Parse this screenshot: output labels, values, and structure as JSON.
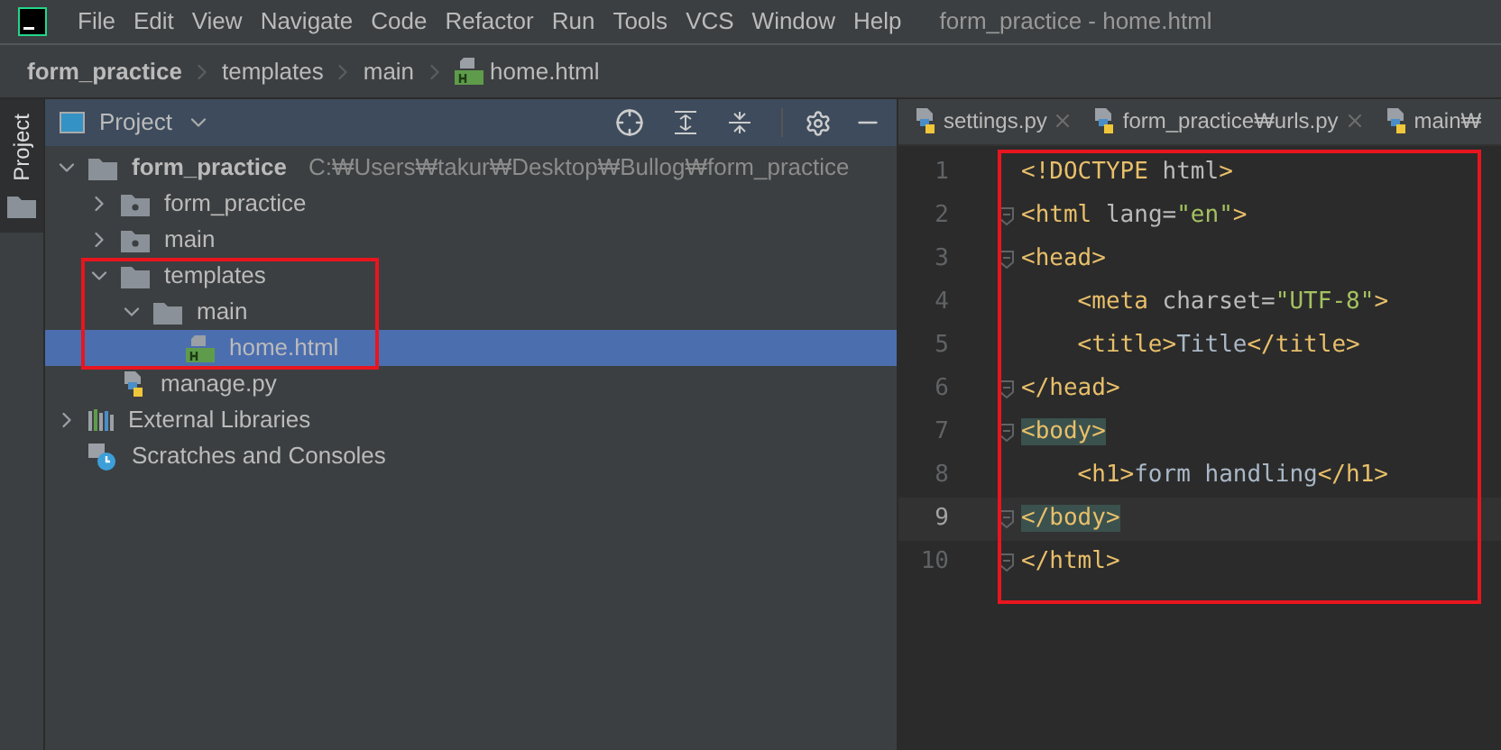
{
  "menu": [
    "File",
    "Edit",
    "View",
    "Navigate",
    "Code",
    "Refactor",
    "Run",
    "Tools",
    "VCS",
    "Window",
    "Help"
  ],
  "window": {
    "title": "form_practice - home.html"
  },
  "breadcrumb": [
    "form_practice",
    "templates",
    "main",
    "home.html"
  ],
  "tool_tab": {
    "label": "Project",
    "selected": true
  },
  "project_panel": {
    "title": "Project",
    "tree": [
      {
        "name": "form_practice",
        "path": "C:₩Users₩takur₩Desktop₩Bullog₩form_practice",
        "kind": "root",
        "expanded": true,
        "selected": false,
        "children": [
          {
            "name": "form_practice",
            "kind": "package",
            "expanded": false,
            "selected": false
          },
          {
            "name": "main",
            "kind": "package",
            "expanded": false,
            "selected": false
          },
          {
            "name": "templates",
            "kind": "folder",
            "expanded": true,
            "selected": false,
            "children": [
              {
                "name": "main",
                "kind": "folder",
                "expanded": true,
                "selected": false,
                "children": [
                  {
                    "name": "home.html",
                    "kind": "html",
                    "selected": true
                  }
                ]
              }
            ]
          },
          {
            "name": "manage.py",
            "kind": "python",
            "selected": false
          }
        ]
      },
      {
        "name": "External Libraries",
        "kind": "libraries",
        "expanded": false,
        "selected": false
      },
      {
        "name": "Scratches and Consoles",
        "kind": "scratches",
        "selected": false
      }
    ]
  },
  "editor_tabs": [
    {
      "label": "settings.py",
      "selected": false,
      "closable": true
    },
    {
      "label": "form_practice₩urls.py",
      "selected": false,
      "closable": true
    },
    {
      "label": "main₩",
      "selected": false
    }
  ],
  "code_lines": [
    {
      "number": "1",
      "current": false,
      "fold": false,
      "tokens": [
        {
          "kind": "tag",
          "text": "<!DOCTYPE "
        },
        {
          "kind": "attr",
          "text": "html"
        },
        {
          "kind": "tag",
          "text": ">"
        }
      ]
    },
    {
      "number": "2",
      "current": false,
      "fold": true,
      "tokens": [
        {
          "kind": "tag",
          "text": "<html "
        },
        {
          "kind": "attr",
          "text": "lang="
        },
        {
          "kind": "string",
          "text": "\"en\""
        },
        {
          "kind": "tag",
          "text": ">"
        }
      ]
    },
    {
      "number": "3",
      "current": false,
      "fold": true,
      "tokens": [
        {
          "kind": "tag",
          "text": "<head>"
        }
      ]
    },
    {
      "number": "4",
      "current": false,
      "fold": false,
      "indent": true,
      "tokens": [
        {
          "kind": "tag",
          "text": "<meta "
        },
        {
          "kind": "attr",
          "text": "charset="
        },
        {
          "kind": "string",
          "text": "\"UTF-8\""
        },
        {
          "kind": "tag",
          "text": ">"
        }
      ]
    },
    {
      "number": "5",
      "current": false,
      "fold": false,
      "indent": true,
      "tokens": [
        {
          "kind": "tag",
          "text": "<title>"
        },
        {
          "kind": "text",
          "text": "Title"
        },
        {
          "kind": "tag",
          "text": "</title>"
        }
      ]
    },
    {
      "number": "6",
      "current": false,
      "fold": true,
      "tokens": [
        {
          "kind": "tag",
          "text": "</head>"
        }
      ]
    },
    {
      "number": "7",
      "current": false,
      "fold": true,
      "tokens": [
        {
          "kind": "matched",
          "text": "<body>"
        }
      ]
    },
    {
      "number": "8",
      "current": false,
      "fold": false,
      "indent": true,
      "tokens": [
        {
          "kind": "tag",
          "text": "<h1>"
        },
        {
          "kind": "text",
          "text": "form handling"
        },
        {
          "kind": "tag",
          "text": "</h1>"
        }
      ]
    },
    {
      "number": "9",
      "current": true,
      "fold": true,
      "tokens": [
        {
          "kind": "matched",
          "text": "</body>"
        }
      ]
    },
    {
      "number": "10",
      "current": false,
      "fold": true,
      "tokens": [
        {
          "kind": "tag",
          "text": "</html>"
        }
      ]
    }
  ]
}
